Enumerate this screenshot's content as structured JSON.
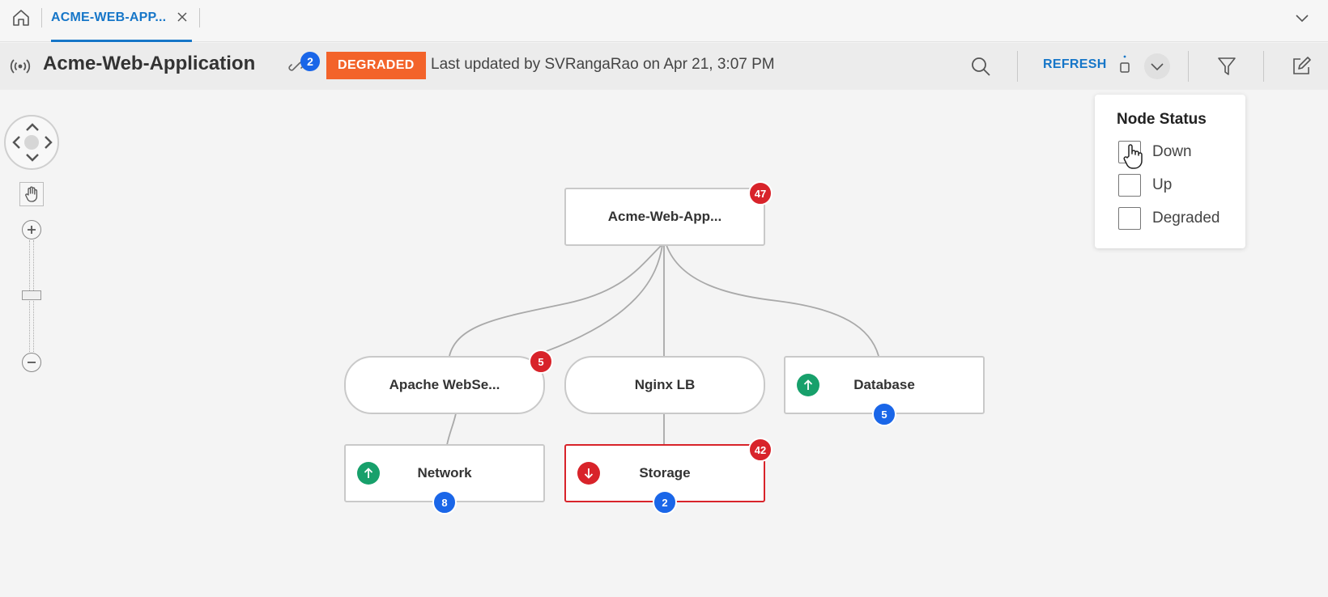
{
  "tabbar": {
    "tab_label": "ACME-WEB-APP..."
  },
  "header": {
    "title": "Acme-Web-Application",
    "link_count": "2",
    "status": "DEGRADED",
    "last_updated": "Last updated by SVRangaRao on Apr 21, 3:07 PM",
    "refresh_label": "REFRESH"
  },
  "colors": {
    "accent": "#1676c8",
    "degraded": "#f3632a",
    "down": "#d8232a",
    "up": "#17a06b",
    "count_blue": "#1a66e8"
  },
  "graph": {
    "root": {
      "label": "Acme-Web-App...",
      "alerts": "47"
    },
    "apache": {
      "label": "Apache WebSe...",
      "alerts": "5"
    },
    "nginx": {
      "label": "Nginx LB"
    },
    "database": {
      "label": "Database",
      "status": "up",
      "count": "5"
    },
    "network": {
      "label": "Network",
      "status": "up",
      "count": "8"
    },
    "storage": {
      "label": "Storage",
      "status": "down",
      "alerts": "42",
      "count": "2"
    }
  },
  "node_status_filter": {
    "title": "Node Status",
    "options": [
      {
        "label": "Down",
        "checked": false
      },
      {
        "label": "Up",
        "checked": false
      },
      {
        "label": "Degraded",
        "checked": false
      }
    ]
  }
}
